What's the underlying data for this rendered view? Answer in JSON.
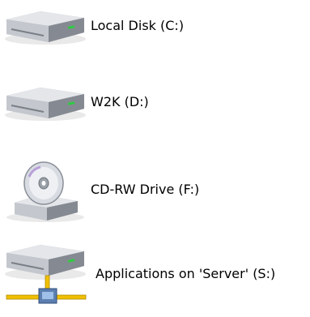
{
  "drives": [
    {
      "label": "Local Disk (C:)",
      "icon": "hard-drive-icon"
    },
    {
      "label": "W2K (D:)",
      "icon": "hard-drive-icon"
    },
    {
      "label": "CD-RW Drive (F:)",
      "icon": "cd-drive-icon"
    },
    {
      "label": "Applications on 'Server' (S:)",
      "icon": "network-drive-icon"
    }
  ],
  "colors": {
    "background": "#ffffff",
    "drive_body": "#b8bcc2",
    "drive_top": "#e4e6ea",
    "led": "#2ecc40",
    "network_cable": "#f0c000"
  }
}
